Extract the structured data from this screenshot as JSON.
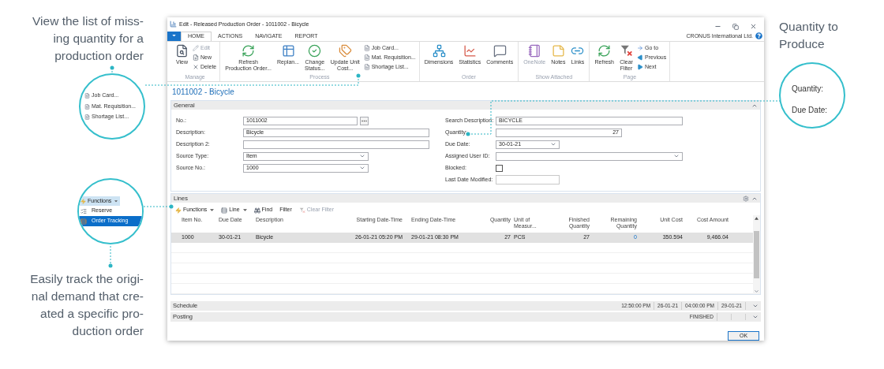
{
  "annotations": {
    "left_top": "View the list of miss-\ning quantity for a\nproduction order",
    "left_bottom": "Easily track the origi-\nnal demand that cre-\nated a specific pro-\nduction order",
    "right_top": "Quantity to\nProduce"
  },
  "callouts": {
    "reports": [
      "Job Card...",
      "Mat. Requisition...",
      "Shortage List..."
    ],
    "functions": {
      "button": "Functions",
      "items": [
        {
          "label": "Reserve",
          "selected": false
        },
        {
          "label": "Order Tracking",
          "selected": true
        }
      ]
    },
    "quantity": [
      "Quantity:",
      "Due Date:"
    ]
  },
  "window": {
    "title": "Edit - Released Production Order - 1011002 - Bicycle",
    "company": "CRONUS International Ltd.",
    "tabs": [
      {
        "label": "HOME",
        "selected": true
      },
      {
        "label": "ACTIONS",
        "selected": false
      },
      {
        "label": "NAVIGATE",
        "selected": false
      },
      {
        "label": "REPORT",
        "selected": false
      }
    ]
  },
  "ribbon": [
    {
      "label": "Manage",
      "items": [
        {
          "kind": "large",
          "label": "View",
          "disabled": false
        },
        {
          "kind": "small",
          "label": "Edit",
          "disabled": true
        },
        {
          "kind": "small",
          "label": "New",
          "disabled": false
        },
        {
          "kind": "small",
          "label": "Delete",
          "disabled": false
        }
      ]
    },
    {
      "label": "Process",
      "items": [
        {
          "kind": "large",
          "label": "Refresh\nProduction Order...",
          "disabled": false
        },
        {
          "kind": "large",
          "label": "Replan...",
          "disabled": false
        },
        {
          "kind": "large",
          "label": "Change\nStatus...",
          "disabled": false
        },
        {
          "kind": "large",
          "label": "Update Unit\nCost...",
          "disabled": false
        },
        {
          "kind": "small",
          "label": "Job Card...",
          "disabled": false
        },
        {
          "kind": "small",
          "label": "Mat. Requisition...",
          "disabled": false
        },
        {
          "kind": "small",
          "label": "Shortage List...",
          "disabled": false
        }
      ]
    },
    {
      "label": "Order",
      "items": [
        {
          "kind": "large",
          "label": "Dimensions",
          "disabled": false
        },
        {
          "kind": "large",
          "label": "Statistics",
          "disabled": false
        },
        {
          "kind": "large",
          "label": "Comments",
          "disabled": false
        }
      ]
    },
    {
      "label": "Show Attached",
      "items": [
        {
          "kind": "large",
          "label": "OneNote",
          "disabled": true
        },
        {
          "kind": "large",
          "label": "Notes",
          "disabled": false
        },
        {
          "kind": "large",
          "label": "Links",
          "disabled": false
        }
      ]
    },
    {
      "label": "Page",
      "items": [
        {
          "kind": "large",
          "label": "Refresh",
          "disabled": false
        },
        {
          "kind": "large",
          "label": "Clear\nFilter",
          "disabled": false
        },
        {
          "kind": "small",
          "label": "Go to",
          "disabled": false
        },
        {
          "kind": "small",
          "label": "Previous",
          "disabled": false
        },
        {
          "kind": "small",
          "label": "Next",
          "disabled": false
        }
      ]
    }
  ],
  "page_title": "1011002 - Bicycle",
  "general": {
    "title": "General",
    "left_fields": [
      {
        "label": "No.:",
        "value": "1011002",
        "kind": "lookup"
      },
      {
        "label": "Description:",
        "value": "Bicycle",
        "kind": "text"
      },
      {
        "label": "Description 2:",
        "kind": "text"
      },
      {
        "label": "Source Type:",
        "value": "Item",
        "kind": "select"
      },
      {
        "label": "Source No.:",
        "value": "1000",
        "kind": "select"
      }
    ],
    "right_fields": [
      {
        "label": "Search Description:",
        "value": "BICYCLE",
        "kind": "text"
      },
      {
        "label": "Quantity:",
        "value": "27",
        "kind": "number"
      },
      {
        "label": "Due Date:",
        "value": "30-01-21",
        "kind": "select"
      },
      {
        "label": "Assigned User ID:",
        "kind": "select"
      },
      {
        "label": "Blocked:",
        "kind": "checkbox",
        "checked": false
      },
      {
        "label": "Last Date Modified:",
        "kind": "readonly"
      }
    ]
  },
  "lines": {
    "title": "Lines",
    "toolbar": [
      {
        "label": "Functions",
        "kind": "menu",
        "disabled": false
      },
      {
        "label": "Line",
        "kind": "menu",
        "disabled": false
      },
      {
        "label": "Find",
        "kind": "button",
        "disabled": false
      },
      {
        "label": "Filter",
        "kind": "button",
        "disabled": false
      },
      {
        "label": "Clear Filter",
        "kind": "button",
        "disabled": true
      }
    ],
    "columns": [
      "Item No.",
      "Due Date",
      "Description",
      "Starting Date-Time",
      "Ending Date-Time",
      "Quantity",
      "Unit of\nMeasur...",
      "Finished\nQuantity",
      "Remaining\nQuantity",
      "Unit Cost",
      "Cost Amount"
    ],
    "rows": [
      {
        "selected": true,
        "cells": [
          "1000",
          "30-01-21",
          "Bicycle",
          "26-01-21 05:20 PM",
          "29-01-21 08:30 PM",
          "27",
          "PCS",
          "27",
          "0",
          "350.594",
          "9,466.04"
        ]
      }
    ]
  },
  "fasttabs": [
    {
      "title": "Schedule",
      "values": [
        "12:50:00 PM",
        "26-01-21",
        "04:00:00 PM",
        "29-01-21"
      ]
    },
    {
      "title": "Posting",
      "values": [
        "FINISHED"
      ]
    }
  ],
  "buttons": [
    "OK"
  ]
}
